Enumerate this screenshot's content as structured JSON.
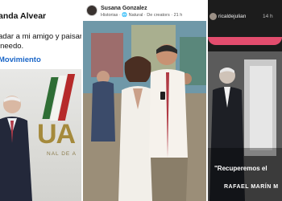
{
  "panel_left": {
    "author": "anda Alvear",
    "post_line_1": "adar a mi amigo y paisano",
    "post_line_2": "ineedo.",
    "hashtag": "Movimiento",
    "logo_text": "UA",
    "logo_subtext": "NAL DE A"
  },
  "panel_middle": {
    "username": "Susana Gonzalez",
    "meta": "Historias · 🌐 Natural · De creators · 21 h"
  },
  "panel_right": {
    "username": "ricaldejulian",
    "time": "14 h",
    "quote": "\"Recuperemos el",
    "author_line": "RAFAEL MARÍN M"
  }
}
